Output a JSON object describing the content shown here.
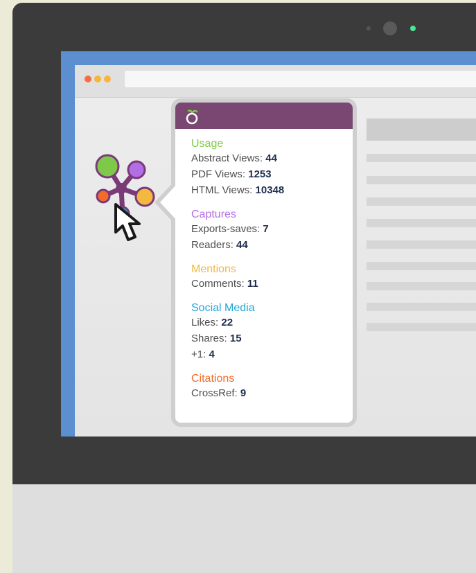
{
  "colors": {
    "usage": "#7fc94a",
    "captures": "#b36ee6",
    "mentions": "#f3b93f",
    "social_media": "#22a7d8",
    "citations": "#f26b2a",
    "header": "#7a4773",
    "value": "#1f2d4f"
  },
  "popup": {
    "header_icon": "plumx-logo-icon",
    "sections": [
      {
        "title": "Usage",
        "metrics": [
          {
            "label": "Abstract Views: ",
            "value": "44"
          },
          {
            "label": "PDF Views: ",
            "value": "1253"
          },
          {
            "label": "HTML Views: ",
            "value": "10348"
          }
        ]
      },
      {
        "title": "Captures",
        "metrics": [
          {
            "label": "Exports-saves: ",
            "value": "7"
          },
          {
            "label": "Readers: ",
            "value": "44"
          }
        ]
      },
      {
        "title": "Mentions",
        "metrics": [
          {
            "label": "Comments: ",
            "value": "11"
          }
        ]
      },
      {
        "title": "Social Media",
        "metrics": [
          {
            "label": "Likes: ",
            "value": "22"
          },
          {
            "label": "Shares: ",
            "value": "15"
          },
          {
            "label": "+1: ",
            "value": "4"
          }
        ]
      },
      {
        "title": "Citations",
        "metrics": [
          {
            "label": "CrossRef: ",
            "value": "9"
          }
        ]
      }
    ]
  },
  "badge": {
    "icon": "plumx-badge-icon"
  },
  "cursor": {
    "icon": "pointer-cursor-icon"
  }
}
